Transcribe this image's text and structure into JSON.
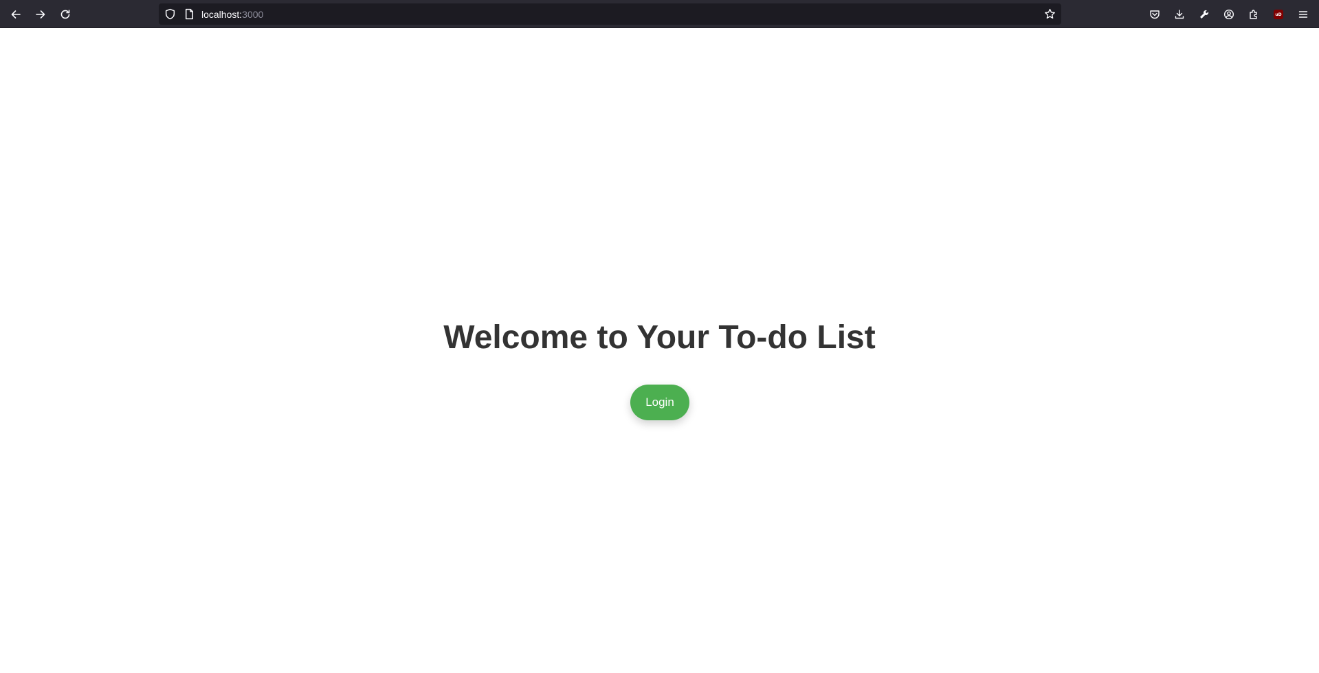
{
  "browser": {
    "url_host": "localhost:",
    "url_port": "3000",
    "toolbar_icons": [
      "back-arrow-icon",
      "forward-arrow-icon",
      "reload-icon",
      "shield-icon",
      "page-icon",
      "bookmark-star-icon",
      "pocket-icon",
      "download-icon",
      "wrench-icon",
      "account-icon",
      "extensions-icon",
      "ublock-icon",
      "menu-icon"
    ],
    "ublock_badge": "uD"
  },
  "page": {
    "title": "Welcome to Your To-do List",
    "login_label": "Login"
  },
  "colors": {
    "toolbar_bg": "#2b2a33",
    "urlbar_bg": "#1c1b22",
    "accent_green": "#4caf50",
    "title_color": "#333333"
  }
}
